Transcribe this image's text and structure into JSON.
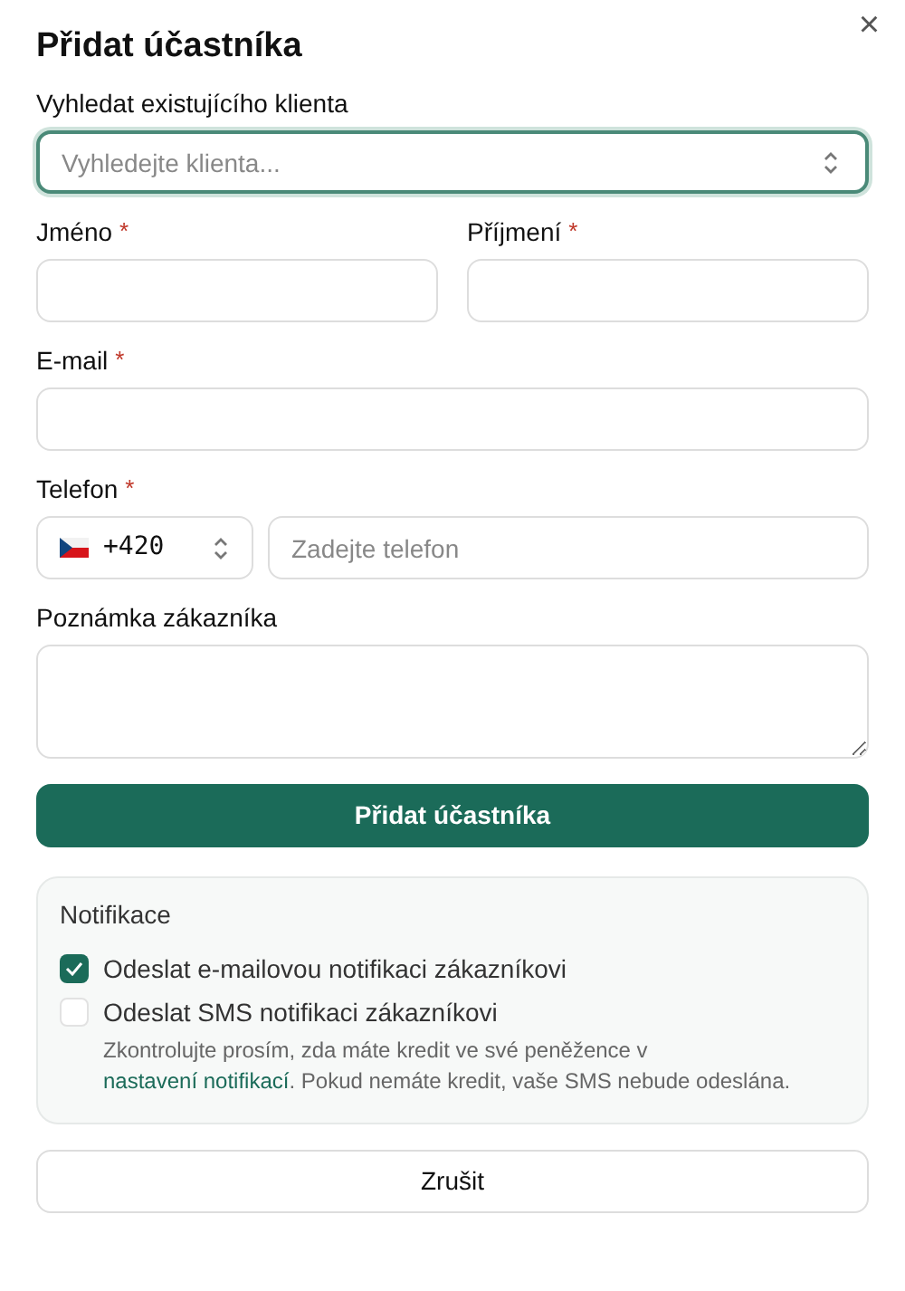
{
  "dialog": {
    "title": "Přidat účastníka",
    "close": "×"
  },
  "search": {
    "label": "Vyhledat existujícího klienta",
    "placeholder": "Vyhledejte klienta...",
    "focused": true
  },
  "name_row": [
    {
      "label": "Jméno",
      "required_mark": "*"
    },
    {
      "label": "Příjmení",
      "required_mark": "*"
    }
  ],
  "email": {
    "label": "E-mail",
    "required_mark": "*"
  },
  "phone": {
    "label": "Telefon",
    "required_mark": "*",
    "country_code": "+420",
    "placeholder": "Zadejte telefon"
  },
  "note": {
    "label": "Poznámka zákazníka"
  },
  "submit": "Přidat účastníka",
  "notifications": {
    "title": "Notifikace",
    "options": [
      {
        "label": "Odeslat e-mailovou notifikaci zákazníkovi",
        "checked": true
      },
      {
        "label": "Odeslat SMS notifikaci zákazníkovi",
        "checked": false,
        "hint_before": "Zkontrolujte prosím, zda máte kredit ve své peněžence v",
        "hint_link": "nastavení notifikací",
        "hint_after": ". Pokud nemáte kredit, vaše SMS nebude odeslána."
      }
    ]
  },
  "cancel": "Zrušit"
}
